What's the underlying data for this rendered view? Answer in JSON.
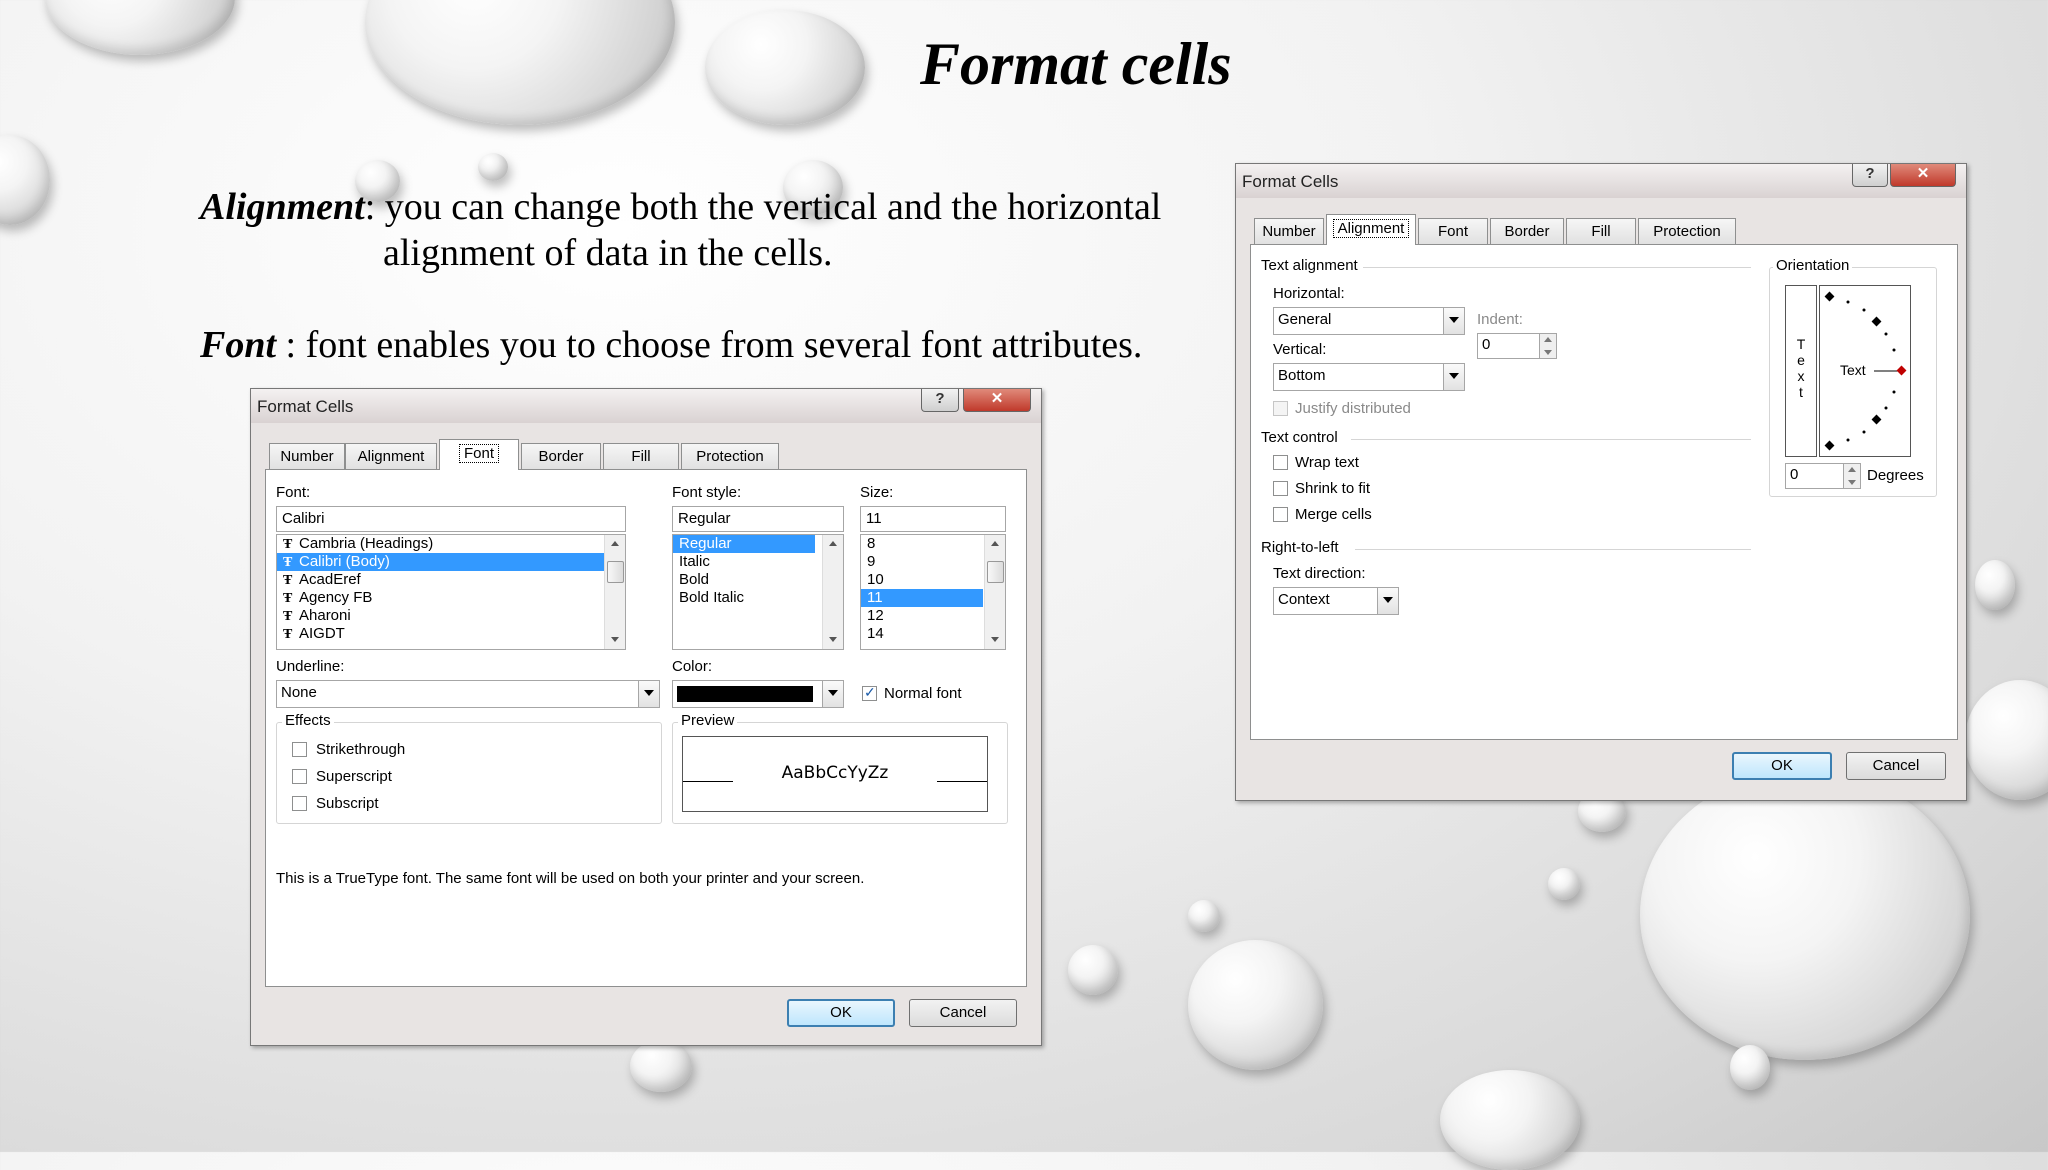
{
  "slide": {
    "title": "Format cells",
    "bullets": [
      {
        "term": "Alignment",
        "text": ": you can change both the vertical and the horizontal",
        "text2": "alignment of data in the cells."
      },
      {
        "term": "Font",
        "text": " : font enables you to choose from several font attributes."
      }
    ]
  },
  "font_dialog": {
    "title": "Format Cells",
    "help": "?",
    "close": "✕",
    "tabs": [
      "Number",
      "Alignment",
      "Font",
      "Border",
      "Fill",
      "Protection"
    ],
    "active_tab": "Font",
    "font_label": "Font:",
    "font_value": "Calibri",
    "font_list": [
      "Cambria (Headings)",
      "Calibri (Body)",
      "AcadEref",
      "Agency FB",
      "Aharoni",
      "AIGDT"
    ],
    "font_selected": "Calibri (Body)",
    "style_label": "Font style:",
    "style_value": "Regular",
    "style_list": [
      "Regular",
      "Italic",
      "Bold",
      "Bold Italic"
    ],
    "style_selected": "Regular",
    "size_label": "Size:",
    "size_value": "11",
    "size_list": [
      "8",
      "9",
      "10",
      "11",
      "12",
      "14"
    ],
    "size_selected": "11",
    "underline_label": "Underline:",
    "underline_value": "None",
    "color_label": "Color:",
    "color_swatch": "#000000",
    "normal_font_label": "Normal font",
    "normal_font_checked": true,
    "effects_label": "Effects",
    "effects": [
      "Strikethrough",
      "Superscript",
      "Subscript"
    ],
    "preview_label": "Preview",
    "preview_text": "AaBbCcYyZz",
    "info_text": "This is a TrueType font.  The same font will be used on both your printer and your screen.",
    "ok": "OK",
    "cancel": "Cancel"
  },
  "align_dialog": {
    "title": "Format Cells",
    "help": "?",
    "close": "✕",
    "tabs": [
      "Number",
      "Alignment",
      "Font",
      "Border",
      "Fill",
      "Protection"
    ],
    "active_tab": "Alignment",
    "text_alignment_label": "Text alignment",
    "horizontal_label": "Horizontal:",
    "horizontal_value": "General",
    "indent_label": "Indent:",
    "indent_value": "0",
    "vertical_label": "Vertical:",
    "vertical_value": "Bottom",
    "justify_label": "Justify distributed",
    "text_control_label": "Text control",
    "text_control": [
      "Wrap text",
      "Shrink to fit",
      "Merge cells"
    ],
    "rtl_label": "Right-to-left",
    "text_direction_label": "Text direction:",
    "text_direction_value": "Context",
    "orientation_label": "Orientation",
    "vertical_text": [
      "T",
      "e",
      "x",
      "t"
    ],
    "dial_text": "Text",
    "degrees_value": "0",
    "degrees_label": "Degrees",
    "ok": "OK",
    "cancel": "Cancel"
  }
}
